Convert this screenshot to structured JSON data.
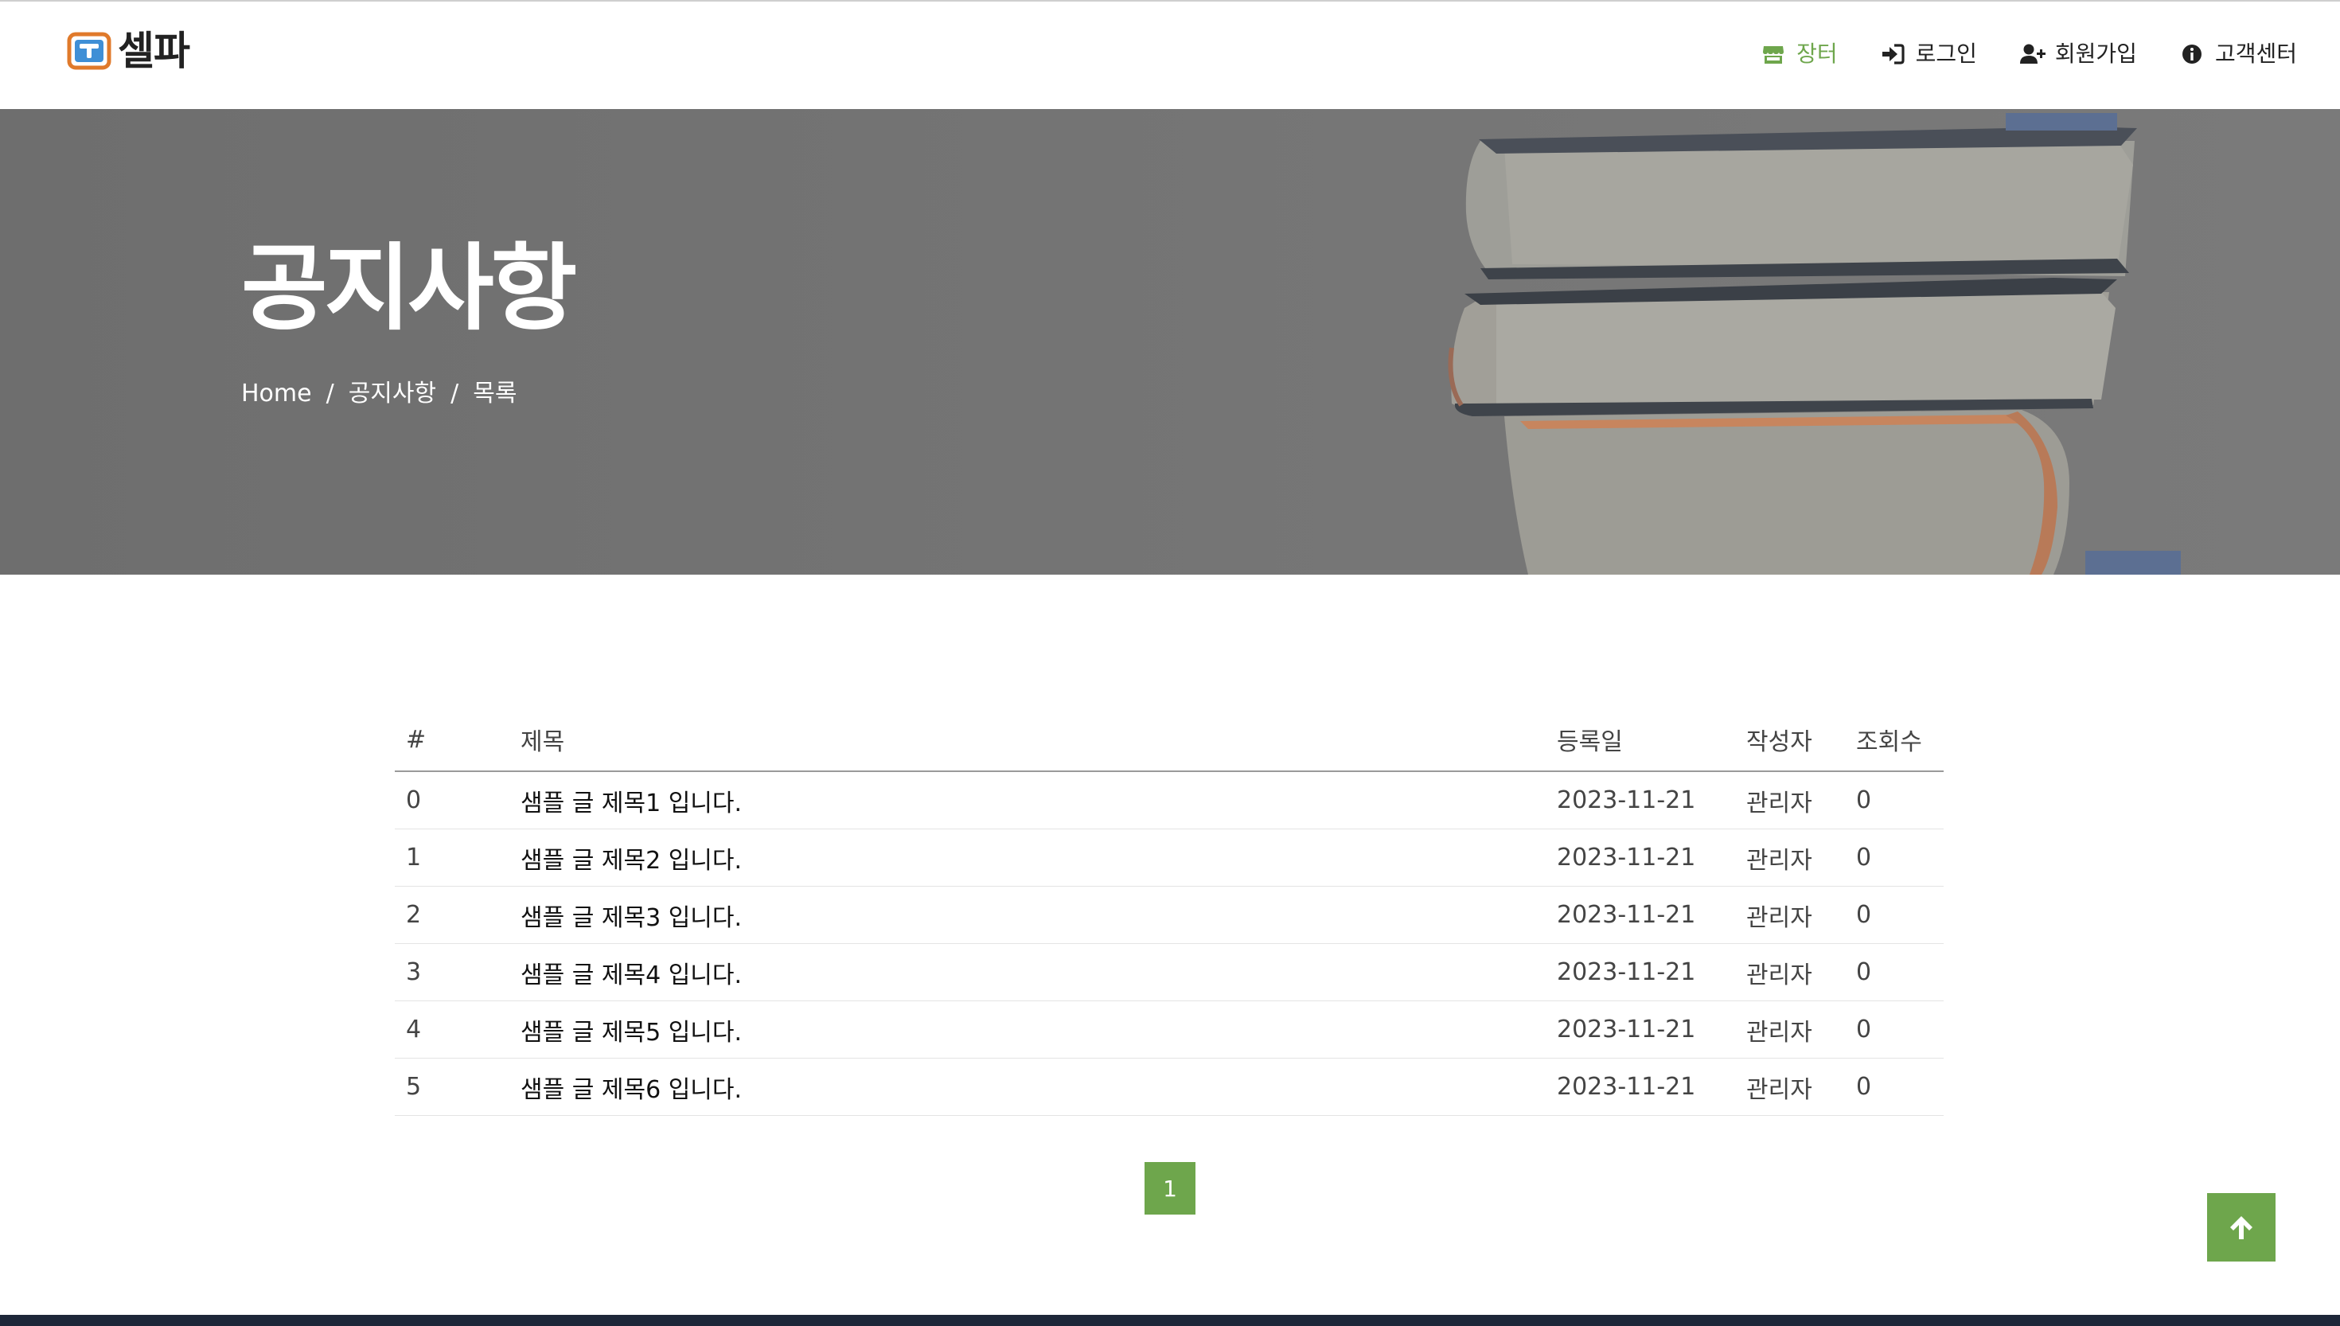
{
  "brand": {
    "logo_text": "셀파",
    "accent": "#6ea64c"
  },
  "nav": {
    "items": [
      {
        "label": "장터",
        "icon": "store-icon",
        "active": true
      },
      {
        "label": "로그인",
        "icon": "sign-in-icon"
      },
      {
        "label": "회원가입",
        "icon": "user-plus-icon"
      },
      {
        "label": "고객센터",
        "icon": "info-circle-icon"
      }
    ]
  },
  "hero": {
    "title": "공지사항",
    "breadcrumb": [
      "Home",
      "공지사항",
      "목록"
    ],
    "separator": "/"
  },
  "board": {
    "columns": [
      "#",
      "제목",
      "등록일",
      "작성자",
      "조회수"
    ],
    "rows": [
      {
        "no": "0",
        "title": "샘플 글 제목1 입니다.",
        "date": "2023-11-21",
        "author": "관리자",
        "views": "0"
      },
      {
        "no": "1",
        "title": "샘플 글 제목2 입니다.",
        "date": "2023-11-21",
        "author": "관리자",
        "views": "0"
      },
      {
        "no": "2",
        "title": "샘플 글 제목3 입니다.",
        "date": "2023-11-21",
        "author": "관리자",
        "views": "0"
      },
      {
        "no": "3",
        "title": "샘플 글 제목4 입니다.",
        "date": "2023-11-21",
        "author": "관리자",
        "views": "0"
      },
      {
        "no": "4",
        "title": "샘플 글 제목5 입니다.",
        "date": "2023-11-21",
        "author": "관리자",
        "views": "0"
      },
      {
        "no": "5",
        "title": "샘플 글 제목6 입니다.",
        "date": "2023-11-21",
        "author": "관리자",
        "views": "0"
      }
    ]
  },
  "pagination": {
    "current": "1"
  },
  "back_to_top": {
    "icon": "arrow-up-icon"
  }
}
